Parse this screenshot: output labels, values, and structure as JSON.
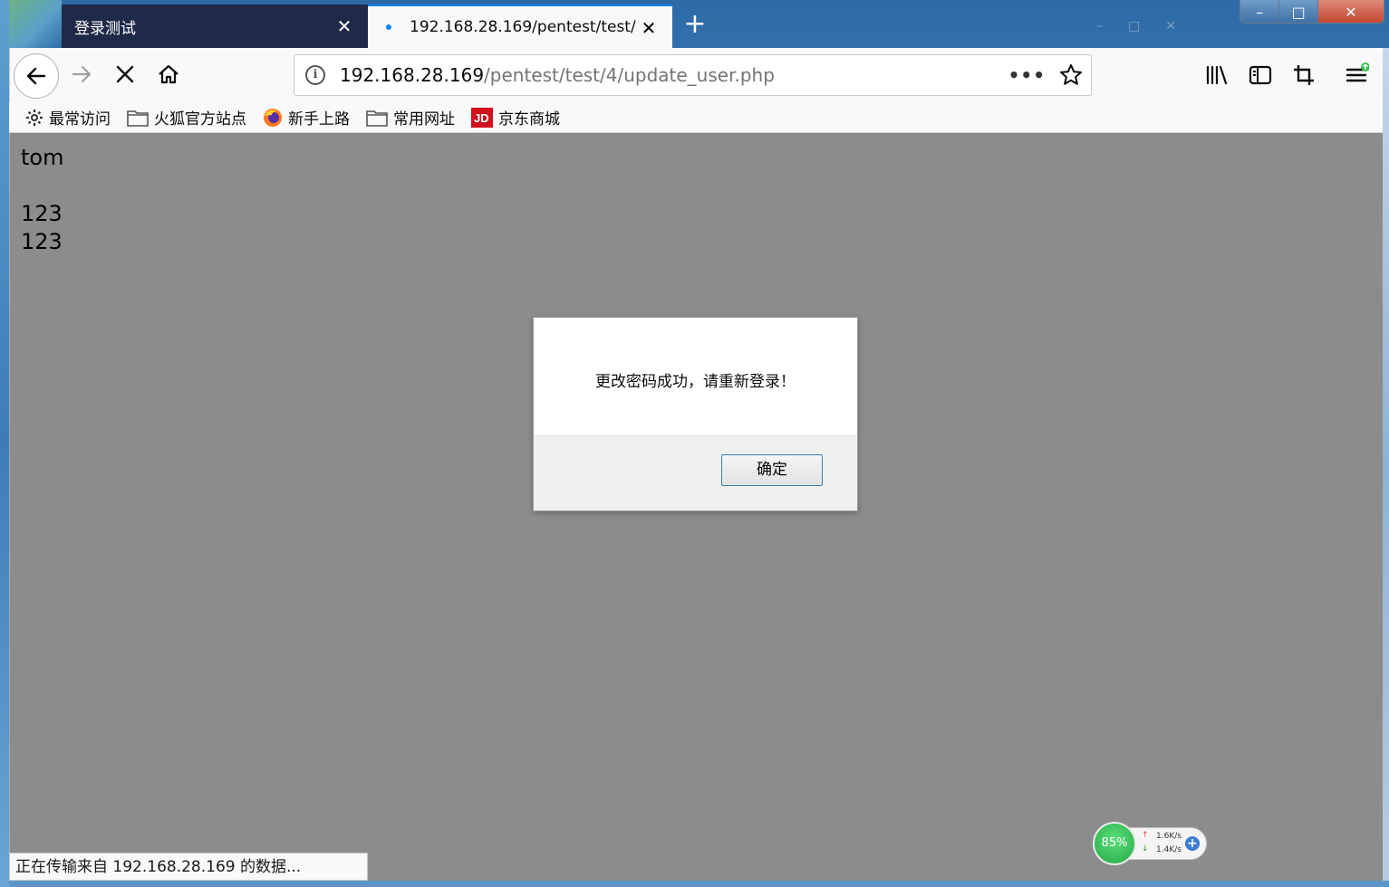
{
  "tabs": [
    {
      "title": "登录测试",
      "active": false
    },
    {
      "title": "192.168.28.169/pentest/test/",
      "active": true
    }
  ],
  "new_tab_glyph": "+",
  "window_controls": {
    "minimize": "–",
    "maximize": "□",
    "close": "✕"
  },
  "url": {
    "host": "192.168.28.169",
    "path": "/pentest/test/4/update_user.php"
  },
  "url_more": "•••",
  "bookmarks": [
    {
      "label": "最常访问",
      "icon": "gear-icon"
    },
    {
      "label": "火狐官方站点",
      "icon": "folder-icon"
    },
    {
      "label": "新手上路",
      "icon": "firefox-icon"
    },
    {
      "label": "常用网址",
      "icon": "folder-icon"
    },
    {
      "label": "京东商城",
      "icon": "jd-icon"
    }
  ],
  "page": {
    "lines": [
      "tom",
      "",
      "123",
      "123"
    ]
  },
  "dialog": {
    "message": "更改密码成功，请重新登录！",
    "ok_label": "确定"
  },
  "status": "正在传输来自 192.168.28.169 的数据...",
  "net_widget": {
    "percent": "85%",
    "upload": "1.6K/s",
    "download": "1.4K/s"
  },
  "colors": {
    "accent": "#0a84ff",
    "content_overlay": "#8c8c8c",
    "inactive_tab": "#1f2a4a"
  }
}
